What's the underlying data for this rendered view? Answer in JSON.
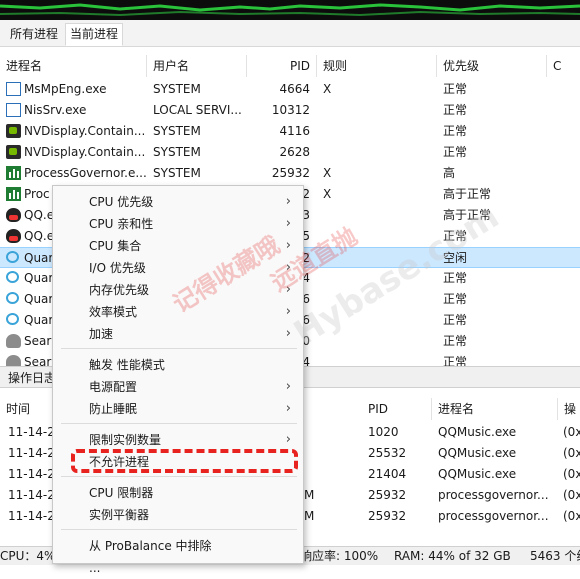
{
  "tabs": [
    "所有进程",
    "当前进程"
  ],
  "active_tab": 1,
  "columns": {
    "name": "进程名",
    "user": "用户名",
    "pid": "PID",
    "rule": "规则",
    "priority": "优先级",
    "extra": "C"
  },
  "processes": [
    {
      "icon": "msmpeng-icon",
      "name": "MsMpEng.exe",
      "user": "SYSTEM",
      "pid": "4664",
      "rule": "X",
      "priority": "正常"
    },
    {
      "icon": "nissrv-icon",
      "name": "NisSrv.exe",
      "user": "LOCAL SERVI...",
      "pid": "10312",
      "rule": "",
      "priority": "正常"
    },
    {
      "icon": "nvidia-icon",
      "name": "NVDisplay.Contain...",
      "user": "SYSTEM",
      "pid": "4116",
      "rule": "",
      "priority": "正常"
    },
    {
      "icon": "nvidia-icon",
      "name": "NVDisplay.Contain...",
      "user": "SYSTEM",
      "pid": "2628",
      "rule": "",
      "priority": "正常"
    },
    {
      "icon": "processgovernor-icon",
      "name": "ProcessGovernor.e...",
      "user": "SYSTEM",
      "pid": "25932",
      "rule": "X",
      "priority": "高"
    },
    {
      "icon": "processgovernor-icon",
      "name": "Proc",
      "user": "",
      "pid": "2",
      "rule": "X",
      "priority": "高于正常"
    },
    {
      "icon": "qq-icon",
      "name": "QQ.e",
      "user": "",
      "pid": "3",
      "rule": "",
      "priority": "高于正常"
    },
    {
      "icon": "qq-icon",
      "name": "QQ.e",
      "user": "",
      "pid": "5",
      "rule": "",
      "priority": "正常"
    },
    {
      "icon": "cloud-icon",
      "name": "Quar",
      "user": "",
      "pid": "2",
      "rule": "",
      "priority": "空闲"
    },
    {
      "icon": "cloud-icon",
      "name": "Quar",
      "user": "",
      "pid": "4",
      "rule": "",
      "priority": "正常"
    },
    {
      "icon": "cloud-icon",
      "name": "Quar",
      "user": "",
      "pid": "6",
      "rule": "",
      "priority": "正常"
    },
    {
      "icon": "cloud-icon",
      "name": "Quar",
      "user": "",
      "pid": "6",
      "rule": "",
      "priority": "正常"
    },
    {
      "icon": "search-icon",
      "name": "Sear",
      "user": "",
      "pid": "0",
      "rule": "",
      "priority": "正常"
    },
    {
      "icon": "search-icon",
      "name": "Sear",
      "user": "",
      "pid": "4",
      "rule": "",
      "priority": "正常"
    }
  ],
  "selected_row": 8,
  "log_section_label": "操作日志",
  "log_columns": {
    "time": "时间",
    "pid": "PID",
    "process": "进程名",
    "action": "操"
  },
  "log_rows": [
    {
      "time": "11-14-2",
      "mid": "",
      "pid": "1020",
      "process": "QQMusic.exe",
      "action": "(0x"
    },
    {
      "time": "11-14-2",
      "mid": "",
      "pid": "25532",
      "process": "QQMusic.exe",
      "action": "(0x"
    },
    {
      "time": "11-14-2",
      "mid": "",
      "pid": "21404",
      "process": "QQMusic.exe",
      "action": "(0x"
    },
    {
      "time": "11-14-2",
      "mid": "M",
      "pid": "25932",
      "process": "processgovernor...",
      "action": "(0x"
    },
    {
      "time": "11-14-2",
      "mid": "M",
      "pid": "25932",
      "process": "processgovernor...",
      "action": "(0x"
    }
  ],
  "status": {
    "cpu": "CPU：4%",
    "response": "响应率: 100%",
    "ram": "RAM: 44% of 32 GB",
    "count": "5463 个线"
  },
  "context_menu": {
    "items": [
      {
        "label": "CPU 优先级",
        "submenu": true
      },
      {
        "label": "CPU 亲和性",
        "submenu": true
      },
      {
        "label": "CPU 集合",
        "submenu": true
      },
      {
        "label": "I/O 优先级",
        "submenu": true
      },
      {
        "label": "内存优先级",
        "submenu": true
      },
      {
        "label": "效率模式",
        "submenu": true
      },
      {
        "label": "加速",
        "submenu": true
      },
      {
        "label": "触发 性能模式",
        "submenu": false
      },
      {
        "label": "电源配置",
        "submenu": true
      },
      {
        "label": "防止睡眠",
        "submenu": true
      },
      {
        "label": "限制实例数量",
        "submenu": true
      },
      {
        "label": "不允许进程",
        "submenu": false
      },
      {
        "label": "CPU 限制器",
        "submenu": false
      },
      {
        "label": "实例平衡器",
        "submenu": false
      },
      {
        "label": "从 ProBalance 中排除",
        "submenu": false
      },
      {
        "label": "...",
        "submenu": false
      }
    ],
    "highlighted_item": "不允许进程",
    "submenu_arrow": "›"
  },
  "watermark": {
    "text1": "记得收藏哦",
    "text2": "远道直抛",
    "text3": "Hybase.com"
  },
  "colors": {
    "selection": "#cce8ff",
    "highlight_dash": "#e8231f",
    "graph_line": "#29c23a"
  }
}
